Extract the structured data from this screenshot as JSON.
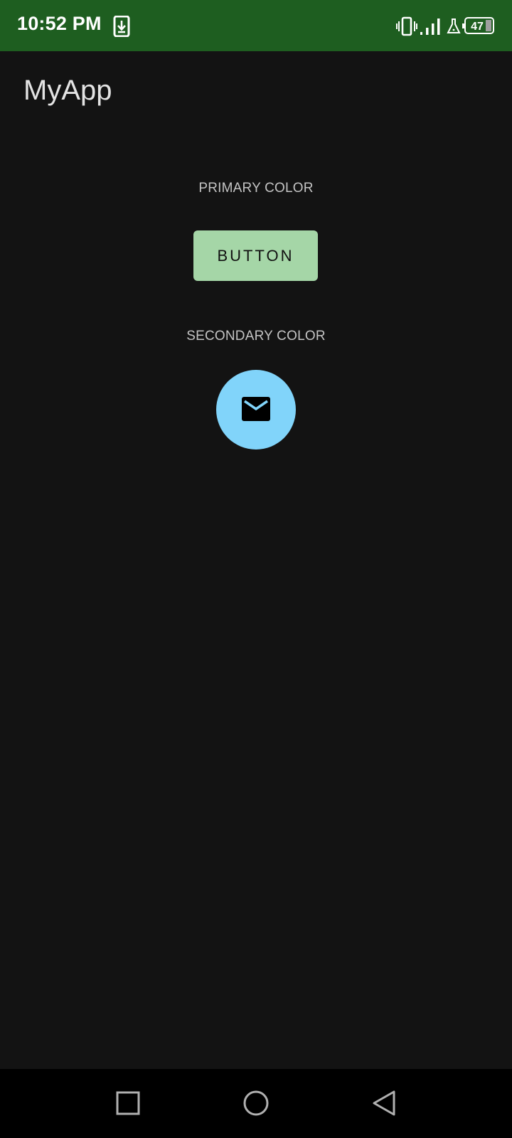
{
  "status_bar": {
    "time": "10:52 PM",
    "battery_level": "47",
    "background_color": "#1e5e20",
    "icons": [
      "download-status-icon",
      "vibrate-icon",
      "signal-icon",
      "lab-icon",
      "battery-icon"
    ]
  },
  "app": {
    "title": "MyApp"
  },
  "content": {
    "primary_label": "PRIMARY COLOR",
    "primary_button_label": "BUTTON",
    "primary_color": "#a5d6a7",
    "secondary_label": "SECONDARY COLOR",
    "secondary_color": "#81d4fa",
    "fab_icon": "mail-icon"
  },
  "nav_bar": {
    "buttons": [
      "recents-button",
      "home-button",
      "back-button"
    ]
  }
}
